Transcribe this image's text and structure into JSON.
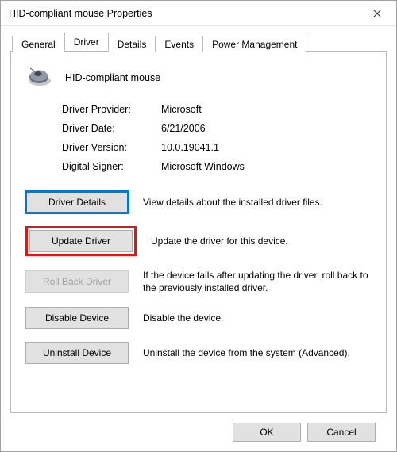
{
  "window": {
    "title": "HID-compliant mouse Properties"
  },
  "tabs": {
    "general": "General",
    "driver": "Driver",
    "details": "Details",
    "events": "Events",
    "power": "Power Management"
  },
  "device": {
    "name": "HID-compliant mouse"
  },
  "info": {
    "provider_label": "Driver Provider:",
    "provider_value": "Microsoft",
    "date_label": "Driver Date:",
    "date_value": "6/21/2006",
    "version_label": "Driver Version:",
    "version_value": "10.0.19041.1",
    "signer_label": "Digital Signer:",
    "signer_value": "Microsoft Windows"
  },
  "actions": {
    "details": {
      "label": "Driver Details",
      "desc": "View details about the installed driver files."
    },
    "update": {
      "label": "Update Driver",
      "desc": "Update the driver for this device."
    },
    "rollback": {
      "label": "Roll Back Driver",
      "desc": "If the device fails after updating the driver, roll back to the previously installed driver."
    },
    "disable": {
      "label": "Disable Device",
      "desc": "Disable the device."
    },
    "uninstall": {
      "label": "Uninstall Device",
      "desc": "Uninstall the device from the system (Advanced)."
    }
  },
  "footer": {
    "ok": "OK",
    "cancel": "Cancel"
  }
}
